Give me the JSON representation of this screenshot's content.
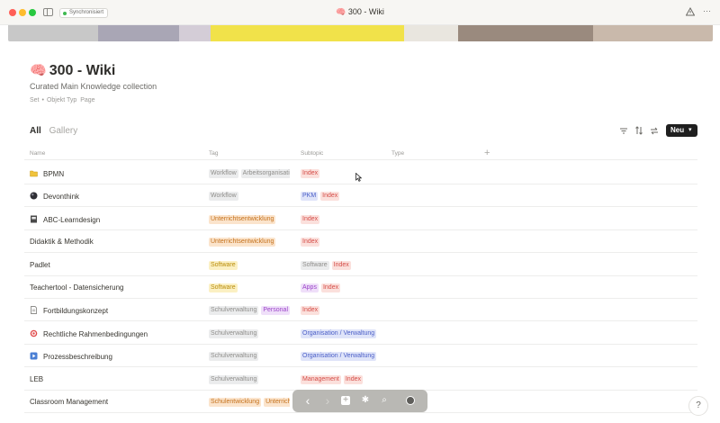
{
  "window": {
    "title": "🧠 300 - Wiki",
    "sync_label": "Synchronisiert"
  },
  "cover_colors": [
    "#c8c8c8",
    "#a9a6b5",
    "#d4cdd7",
    "#f1e24a",
    "#e9e6df",
    "#9a8a7e",
    "#c9b9ab"
  ],
  "page": {
    "emoji": "🧠",
    "title": "300 - Wiki",
    "subtitle": "Curated Main Knowledge collection",
    "meta_set": "Set",
    "meta_sep": "•",
    "meta_object_type": "Objekt Typ",
    "meta_page": "Page"
  },
  "views": {
    "tabs": [
      {
        "label": "All",
        "active": true
      },
      {
        "label": "Gallery",
        "active": false
      }
    ],
    "new_button": "Neu"
  },
  "table": {
    "columns": [
      "Name",
      "Tag",
      "Subtopic",
      "Type"
    ],
    "add_column_glyph": "+",
    "rows": [
      {
        "icon": "folder-yellow",
        "name": "BPMN",
        "tags": [
          {
            "t": "Workflow",
            "c": "gray"
          },
          {
            "t": "Arbeitsorganisation",
            "c": "gray"
          }
        ],
        "sub": [
          {
            "t": "Index",
            "c": "red"
          }
        ]
      },
      {
        "icon": "sphere-dark",
        "name": "Devonthink",
        "tags": [
          {
            "t": "Workflow",
            "c": "gray"
          }
        ],
        "sub": [
          {
            "t": "PKM",
            "c": "blue"
          },
          {
            "t": "Index",
            "c": "red"
          }
        ]
      },
      {
        "icon": "book-dark",
        "name": "ABC-Learndesign",
        "tags": [
          {
            "t": "Unterrichtsentwicklung",
            "c": "orange"
          }
        ],
        "sub": [
          {
            "t": "Index",
            "c": "red"
          }
        ]
      },
      {
        "icon": "",
        "name": "Didaktik & Methodik",
        "tags": [
          {
            "t": "Unterrichtsentwicklung",
            "c": "orange"
          }
        ],
        "sub": [
          {
            "t": "Index",
            "c": "red"
          }
        ]
      },
      {
        "icon": "",
        "name": "Padlet",
        "tags": [
          {
            "t": "Software",
            "c": "yellow"
          }
        ],
        "sub": [
          {
            "t": "Software",
            "c": "gray"
          },
          {
            "t": "Index",
            "c": "red"
          }
        ]
      },
      {
        "icon": "",
        "name": "Teachertool - Datensicherung",
        "tags": [
          {
            "t": "Software",
            "c": "yellow"
          }
        ],
        "sub": [
          {
            "t": "Apps",
            "c": "purple"
          },
          {
            "t": "Index",
            "c": "red"
          }
        ]
      },
      {
        "icon": "document",
        "name": "Fortbildungskonzept",
        "tags": [
          {
            "t": "Schulverwaltung",
            "c": "gray"
          },
          {
            "t": "Personal",
            "c": "purple"
          }
        ],
        "sub": [
          {
            "t": "Index",
            "c": "red"
          }
        ]
      },
      {
        "icon": "target",
        "name": "Rechtliche Rahmenbedingungen",
        "tags": [
          {
            "t": "Schulverwaltung",
            "c": "gray"
          }
        ],
        "sub": [
          {
            "t": "Organisation / Verwaltung",
            "c": "blue"
          }
        ]
      },
      {
        "icon": "play-blue",
        "name": "Prozessbeschreibung",
        "tags": [
          {
            "t": "Schulverwaltung",
            "c": "gray"
          }
        ],
        "sub": [
          {
            "t": "Organisation / Verwaltung",
            "c": "blue"
          }
        ]
      },
      {
        "icon": "",
        "name": "LEB",
        "tags": [
          {
            "t": "Schulverwaltung",
            "c": "gray"
          }
        ],
        "sub": [
          {
            "t": "Management",
            "c": "red"
          },
          {
            "t": "Index",
            "c": "red"
          }
        ]
      },
      {
        "icon": "",
        "name": "Classroom Management",
        "tags": [
          {
            "t": "Schulentwicklung",
            "c": "orange"
          },
          {
            "t": "Unterricht",
            "c": "orange"
          }
        ],
        "sub": [
          {
            "t": "Index",
            "c": "red"
          }
        ]
      }
    ]
  },
  "toolbar": {
    "back_glyph": "‹",
    "forward_glyph": "›",
    "new_glyph": "+",
    "graph_glyph": "✱",
    "search_glyph": "⌕"
  },
  "help_glyph": "?"
}
